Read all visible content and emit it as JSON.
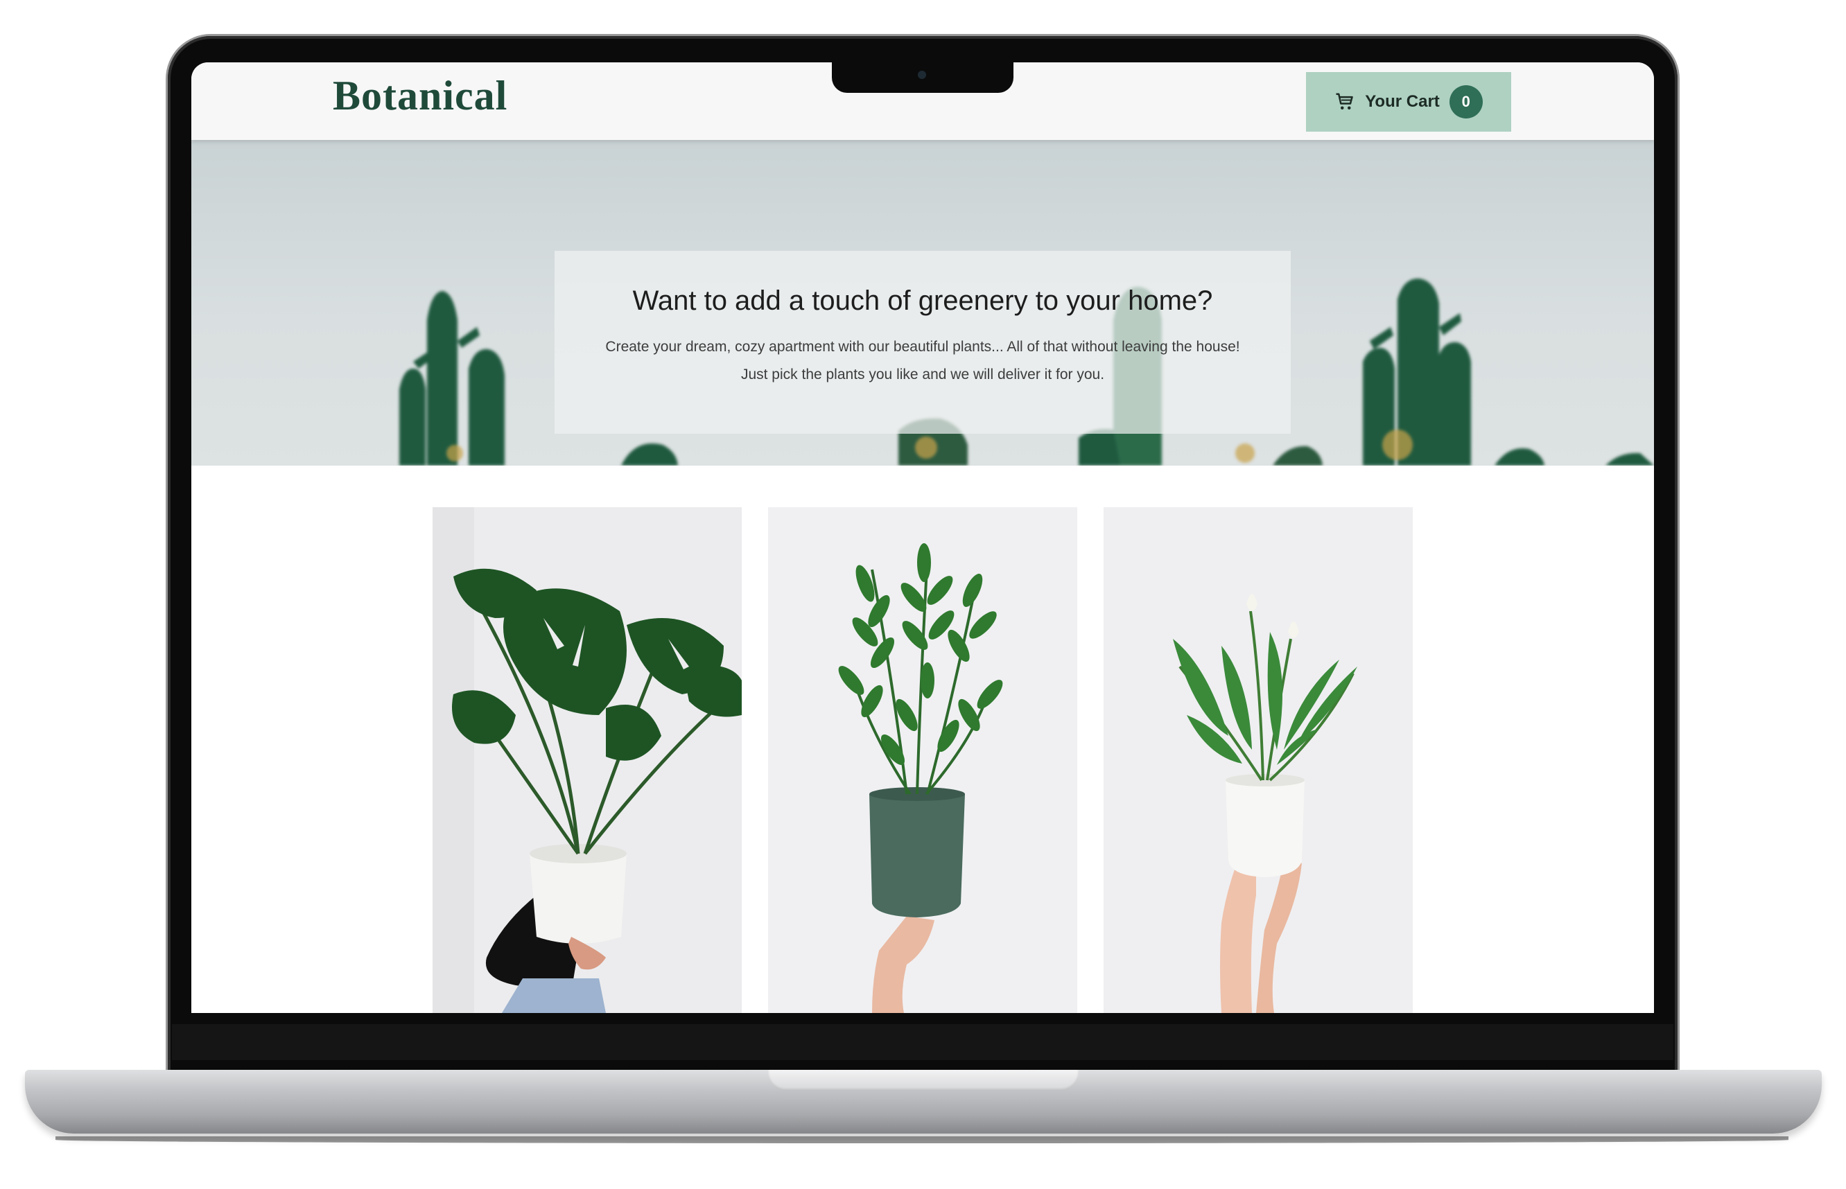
{
  "site": {
    "brand": "Botanical"
  },
  "header": {
    "cart_label": "Your Cart",
    "cart_count": "0",
    "cart_icon": "cart-icon"
  },
  "hero": {
    "title": "Want to add a touch of greenery to your home?",
    "text": "Create your dream, cozy apartment with our beautiful plants... All of that without leaving the house! Just pick the plants you like and we will deliver it for you."
  },
  "products": [
    {
      "image": "monstera-plant-photo"
    },
    {
      "image": "zz-plant-photo"
    },
    {
      "image": "peace-lily-photo"
    }
  ],
  "colors": {
    "brand": "#1f4a3a",
    "cart_bg": "#aed1c2",
    "badge": "#2f6e57"
  }
}
